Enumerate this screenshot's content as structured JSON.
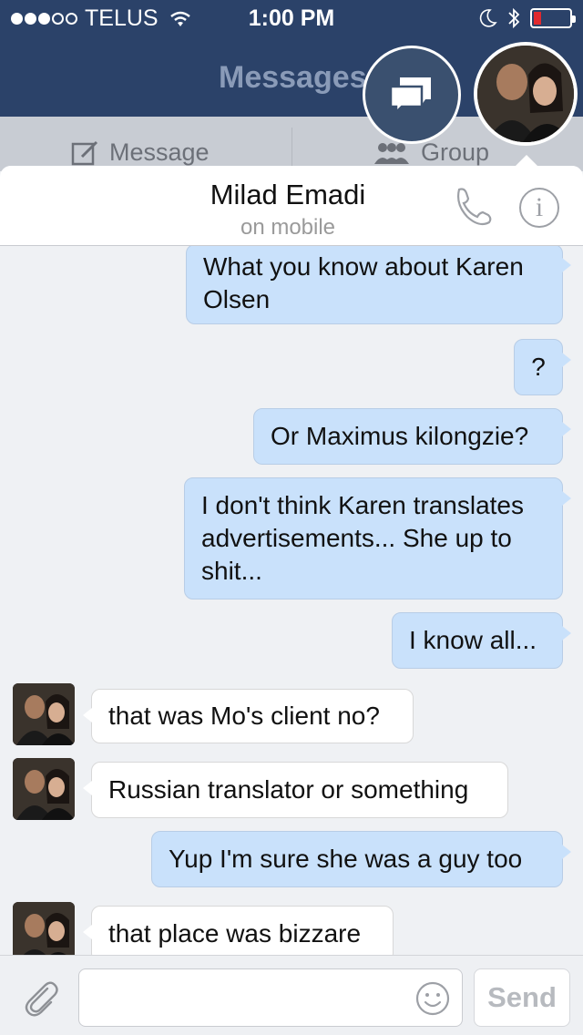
{
  "status_bar": {
    "carrier": "TELUS",
    "time": "1:00 PM",
    "signal_bars_filled": 3,
    "signal_bars_total": 5,
    "battery_level": "low",
    "icons": [
      "wifi-icon",
      "moon-icon",
      "bluetooth-icon",
      "battery-icon"
    ]
  },
  "nav": {
    "title": "Messages"
  },
  "segments": {
    "message_label": "Message",
    "group_label": "Group"
  },
  "chat": {
    "contact_name": "Milad Emadi",
    "contact_status": "on mobile",
    "messages": [
      {
        "direction": "out",
        "text": "What you know about Karen Olsen"
      },
      {
        "direction": "out",
        "text": "?"
      },
      {
        "direction": "out",
        "text": "Or Maximus kilongzie?"
      },
      {
        "direction": "out",
        "text": "I don't think Karen translates advertisements...  She up to shit..."
      },
      {
        "direction": "out",
        "text": "I know all..."
      },
      {
        "direction": "in",
        "text": "that was Mo's client no?"
      },
      {
        "direction": "in",
        "text": "Russian translator or something"
      },
      {
        "direction": "out",
        "text": "Yup I'm sure she was a guy too"
      },
      {
        "direction": "in",
        "text": "that place was bizzare"
      }
    ]
  },
  "composer": {
    "input_value": "",
    "send_label": "Send"
  },
  "colors": {
    "nav_bg": "#2b4269",
    "outgoing_bubble": "#c9e1fb",
    "incoming_bubble": "#ffffff",
    "battery_low": "#e0292e"
  }
}
